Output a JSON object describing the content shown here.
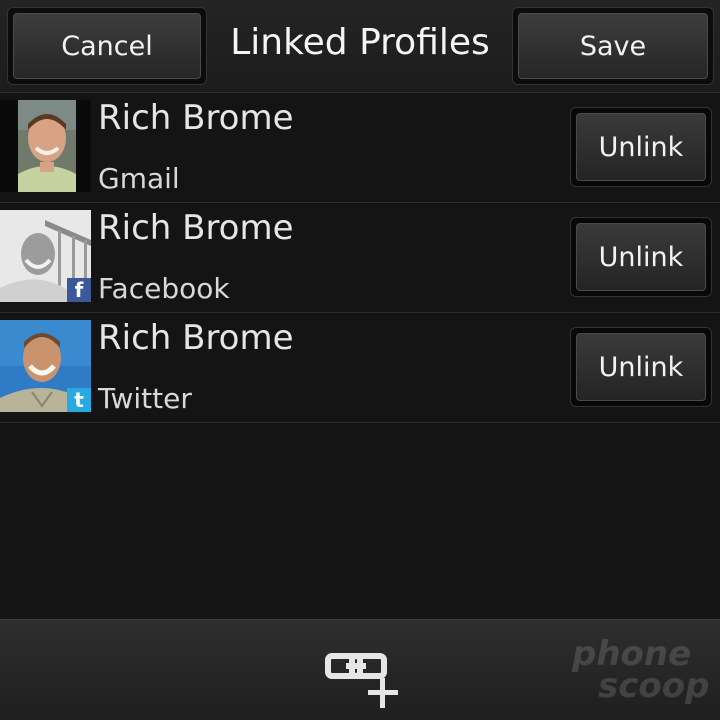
{
  "header": {
    "title": "Linked Profiles",
    "cancel_label": "Cancel",
    "save_label": "Save"
  },
  "profiles": [
    {
      "name": "Rich Brome",
      "service": "Gmail",
      "badge": "",
      "action_label": "Unlink"
    },
    {
      "name": "Rich Brome",
      "service": "Facebook",
      "badge": "f",
      "action_label": "Unlink"
    },
    {
      "name": "Rich Brome",
      "service": "Twitter",
      "badge": "t",
      "action_label": "Unlink"
    }
  ],
  "footer": {
    "link_icon": "link-add-icon",
    "watermark_line1": "phone",
    "watermark_line2": "scoop"
  },
  "colors": {
    "background": "#141414",
    "facebook_badge": "#3b5998",
    "twitter_badge": "#29a9e1"
  }
}
